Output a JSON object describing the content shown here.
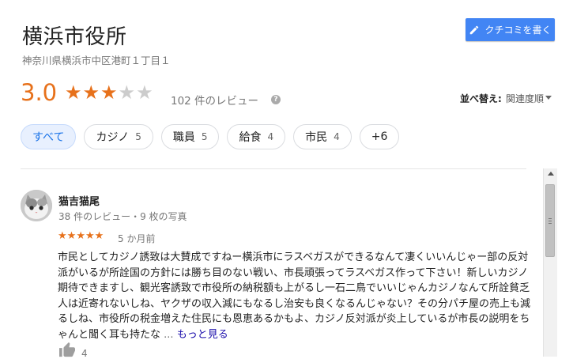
{
  "place": {
    "name": "横浜市役所",
    "address": "神奈川県横浜市中区港町１丁目１"
  },
  "write_review_button": {
    "label": "クチコミを書く",
    "icon": "pencil-icon"
  },
  "summary": {
    "rating": "3.0",
    "stars_filled": 3,
    "stars_total": 5,
    "review_count_text": "102 件のレビュー"
  },
  "sort": {
    "label": "並べ替え:",
    "value": "関連度順"
  },
  "filters": [
    {
      "label": "すべて",
      "count": "",
      "active": true
    },
    {
      "label": "カジノ",
      "count": "5",
      "active": false
    },
    {
      "label": "職員",
      "count": "5",
      "active": false
    },
    {
      "label": "給食",
      "count": "4",
      "active": false
    },
    {
      "label": "市民",
      "count": "4",
      "active": false
    },
    {
      "label": "+6",
      "count": "",
      "active": false
    }
  ],
  "review": {
    "author": "猫吉猫尾",
    "meta": "38 件のレビュー・9 枚の写真",
    "stars": 5,
    "date": "5 か月前",
    "text": "市民としてカジノ誘致は大賛成ですねー横浜市にラスベガスができるなんて凄くいいんじゃー部の反対派がいるが所詮国の方針には勝ち目のない戦い、市長頑張ってラスベガス作って下さい！新しいカジノ期待できますし、観光客誘致で市役所の納税額も上がるし一石二鳥でいいじゃんカジノなんて所詮貧乏人は近寄れないしね、ヤクザの収入減にもなるし治安も良くなるんじゃない？その分パチ屋の売上も減るしね、市役所の税金増えた住民にも恩恵あるかもよ、カジノ反対派が炎上しているが市長の説明をちゃんと聞く耳も持たな",
    "ellipsis": "...",
    "more": "もっと見る",
    "likes": "4"
  }
}
